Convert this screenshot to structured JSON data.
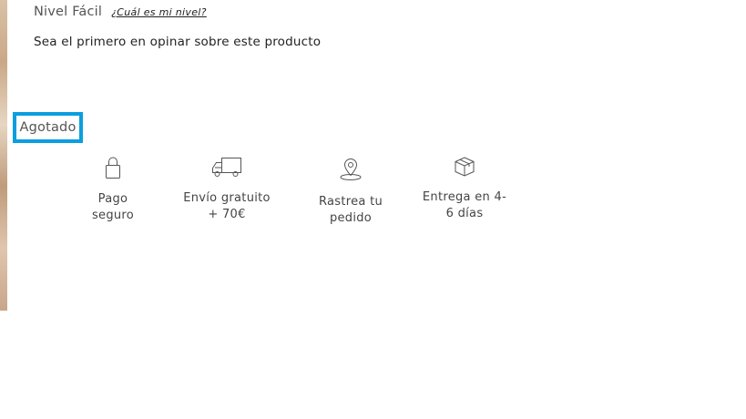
{
  "product": {
    "level_label": "Nivel Fácil",
    "level_link": "¿Cuál es mi nivel?",
    "review_prompt": "Sea el primero en opinar sobre este producto",
    "stock_status": "Agotado"
  },
  "features": {
    "payment": {
      "icon": "lock-icon",
      "label": "Pago\nseguro"
    },
    "shipping": {
      "icon": "truck-icon",
      "label": "Envío gratuito\n+ 70€"
    },
    "tracking": {
      "icon": "map-pin-icon",
      "label": "Rastrea tu\npedido"
    },
    "delivery": {
      "icon": "box-icon",
      "label": "Entrega en 4-\n6 días"
    }
  },
  "colors": {
    "badge_border": "#0b9ee0",
    "text": "#444444"
  }
}
